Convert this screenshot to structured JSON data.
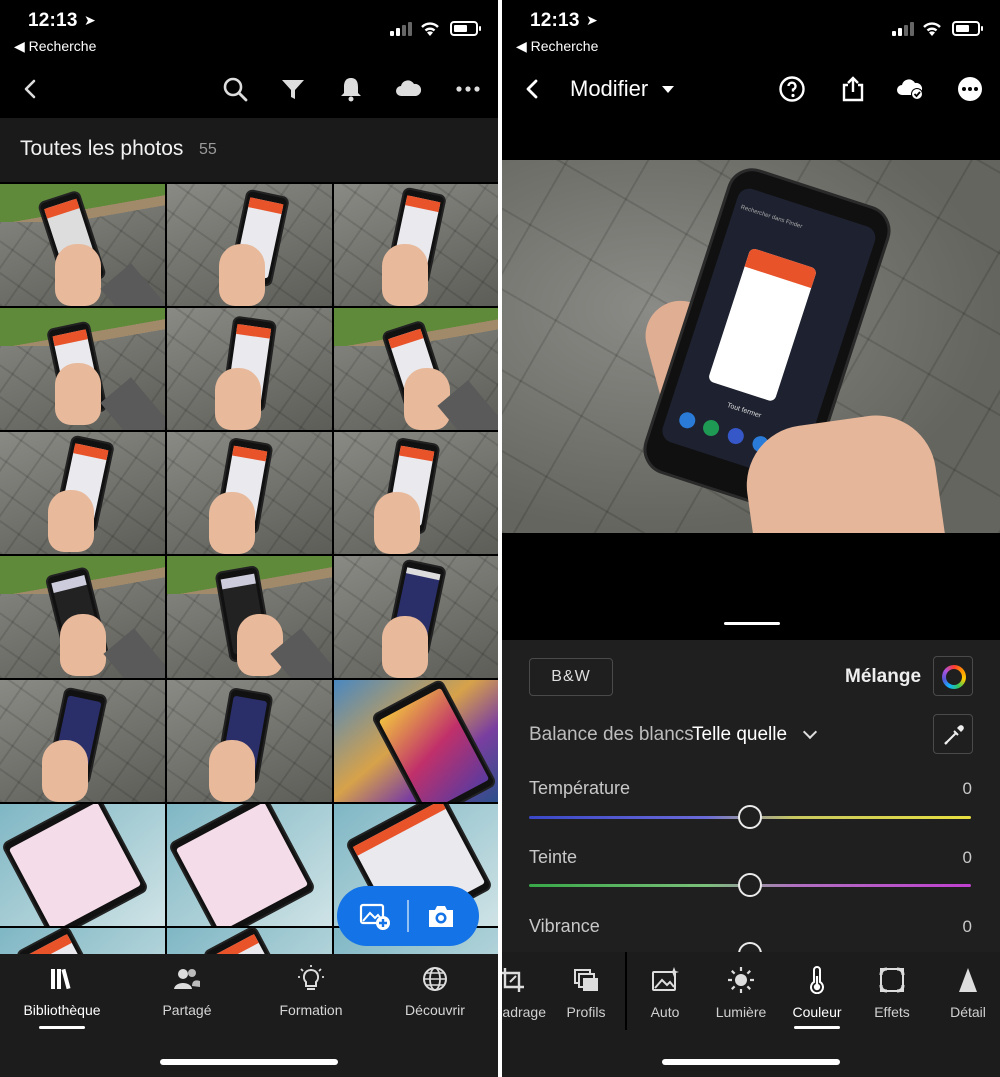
{
  "status_left": {
    "time": "12:13",
    "back_app": "◀ Recherche"
  },
  "status_right": {
    "time": "12:13",
    "back_app": "◀ Recherche"
  },
  "library": {
    "section_title": "Toutes les photos",
    "count": "55",
    "toolbar_icons": [
      "back-icon",
      "search-icon",
      "filter-icon",
      "bell-icon",
      "cloud-icon",
      "more-icon"
    ],
    "tabs": [
      {
        "label": "Bibliothèque",
        "icon": "library-icon",
        "active": true
      },
      {
        "label": "Partagé",
        "icon": "people-icon",
        "active": false
      },
      {
        "label": "Formation",
        "icon": "lightbulb-icon",
        "active": false
      },
      {
        "label": "Découvrir",
        "icon": "globe-icon",
        "active": false
      }
    ]
  },
  "editor": {
    "title": "Modifier",
    "header_icons": [
      "back-icon",
      "help-icon",
      "share-icon",
      "cloud-synced-icon",
      "more-icon"
    ],
    "bw_label": "B&W",
    "melange_label": "Mélange",
    "wb_label": "Balance des blancs",
    "wb_value": "Telle quelle",
    "sliders": [
      {
        "label": "Température",
        "value": "0",
        "position": 0.5
      },
      {
        "label": "Teinte",
        "value": "0",
        "position": 0.5
      },
      {
        "label": "Vibrance",
        "value": "0",
        "position": 0.5
      }
    ],
    "tabs": [
      {
        "label": "Recadrage",
        "display": "adrage",
        "icon": "crop-icon"
      },
      {
        "label": "Profils",
        "icon": "profiles-icon"
      },
      {
        "label": "Auto",
        "icon": "auto-icon"
      },
      {
        "label": "Lumière",
        "icon": "sun-icon"
      },
      {
        "label": "Couleur",
        "icon": "thermometer-icon",
        "active": true
      },
      {
        "label": "Effets",
        "icon": "effects-icon"
      },
      {
        "label": "Détail",
        "icon": "detail-icon"
      }
    ],
    "colors": {
      "accent": "#1473e6",
      "panel": "#1f1f1f",
      "orange": "#e8532a"
    }
  }
}
